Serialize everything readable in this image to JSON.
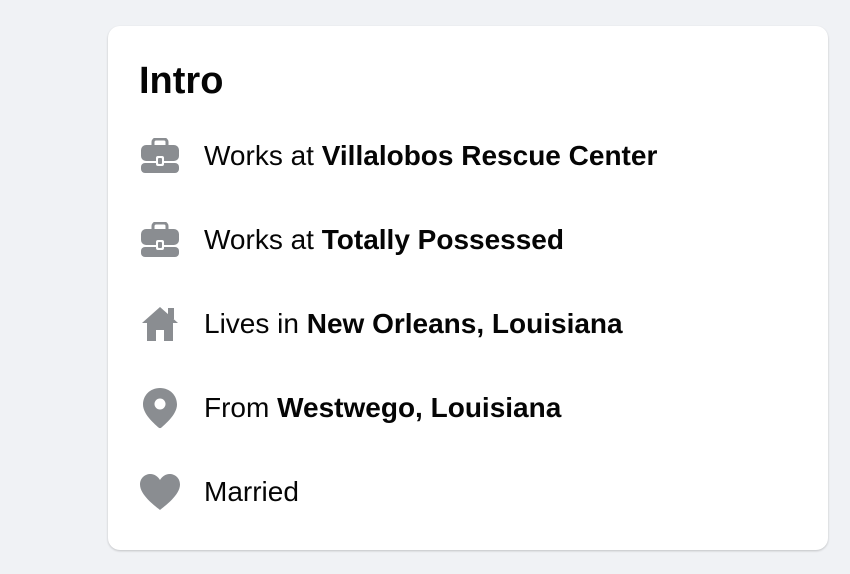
{
  "intro": {
    "title": "Intro",
    "items": [
      {
        "icon": "briefcase-icon",
        "prefix": "Works at ",
        "value": "Villalobos Rescue Center"
      },
      {
        "icon": "briefcase-icon",
        "prefix": "Works at ",
        "value": "Totally Possessed"
      },
      {
        "icon": "home-icon",
        "prefix": "Lives in ",
        "value": "New Orleans, Louisiana"
      },
      {
        "icon": "location-pin-icon",
        "prefix": "From ",
        "value": "Westwego, Louisiana"
      },
      {
        "icon": "heart-icon",
        "prefix": "Married",
        "value": ""
      }
    ]
  },
  "colors": {
    "icon": "#8a8d91",
    "text": "#050505",
    "card_bg": "#ffffff",
    "page_bg": "#f0f2f5"
  }
}
